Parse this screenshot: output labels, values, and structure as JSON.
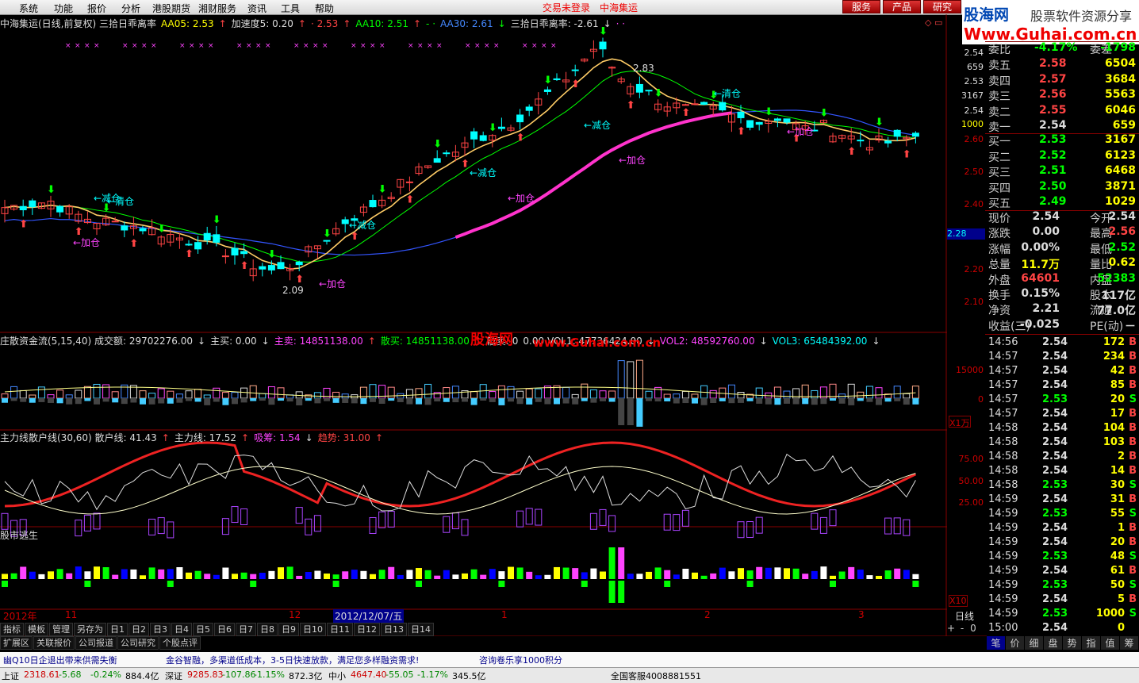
{
  "menu": [
    "系统",
    "功能",
    "报价",
    "分析",
    "港股期货",
    "湘财服务",
    "资讯",
    "工具",
    "帮助"
  ],
  "top_links": [
    "交易未登录",
    "中海集运"
  ],
  "top_buttons": [
    "服务",
    "产品",
    "研究"
  ],
  "logo": {
    "l1": "股海网",
    "l1b": "股票软件资源分享",
    "l2": "Www.Guhai.com.cn"
  },
  "main_header": [
    {
      "t": "中海集运(日线,前复权) 三拾日乖离率",
      "c": "w"
    },
    {
      "t": "AA05: 2.53",
      "c": "y"
    },
    {
      "t": "↑",
      "c": "r"
    },
    {
      "t": "加速度5: 0.20",
      "c": "w"
    },
    {
      "t": "↑",
      "c": "r"
    },
    {
      "t": "· 2.53",
      "c": "r"
    },
    {
      "t": "↑",
      "c": "r"
    },
    {
      "t": "AA10: 2.51",
      "c": "g"
    },
    {
      "t": "↑",
      "c": "r"
    },
    {
      "t": "- ·",
      "c": "g"
    },
    {
      "t": "AA30: 2.61",
      "c": "b"
    },
    {
      "t": "↓",
      "c": "g"
    },
    {
      "t": "三拾日乖离率: -2.61",
      "c": "w"
    },
    {
      "t": "↓",
      "c": "w"
    },
    {
      "t": "· ·",
      "c": "m"
    }
  ],
  "main_axis": [
    "2.60",
    "2.50",
    "2.40",
    "2.30",
    "2.20",
    "2.10"
  ],
  "cursor_price": "2.28",
  "annotations": [
    {
      "t": "←减仓",
      "c": "c"
    },
    {
      "t": "←清仓",
      "c": "c"
    },
    {
      "t": "←加仓",
      "c": "m"
    },
    {
      "t": "←减仓",
      "c": "c"
    },
    {
      "t": "←加仓",
      "c": "m"
    },
    {
      "t": "←减仓",
      "c": "c"
    },
    {
      "t": "←加仓",
      "c": "m"
    },
    {
      "t": "←减仓",
      "c": "c"
    },
    {
      "t": "←加仓",
      "c": "m"
    },
    {
      "t": "←清仓",
      "c": "c"
    },
    {
      "t": "←加仓",
      "c": "m"
    },
    {
      "t": "2.83",
      "c": "w"
    },
    {
      "t": "2.09",
      "c": "w"
    }
  ],
  "panel2_header": [
    {
      "t": "庄散资金流(5,15,40) 成交额: 29702276.00",
      "c": "w"
    },
    {
      "t": "↓",
      "c": "w"
    },
    {
      "t": "主买: 0.00",
      "c": "w"
    },
    {
      "t": "↓",
      "c": "w"
    },
    {
      "t": "主卖: 14851138.00",
      "c": "m"
    },
    {
      "t": "↑",
      "c": "r"
    },
    {
      "t": "散买: 14851138.00",
      "c": "g"
    },
    {
      "t": "↑",
      "c": "r"
    },
    {
      "t": "散卖: 0",
      "c": "w"
    },
    {
      "t": "0.00 VOL1: 47736424.00",
      "c": "w"
    },
    {
      "t": "↓",
      "c": "w"
    },
    {
      "t": "VOL2: 48592760.00",
      "c": "m"
    },
    {
      "t": "↓",
      "c": "w"
    },
    {
      "t": "VOL3: 65484392.00",
      "c": "c"
    },
    {
      "t": "↓",
      "c": "w"
    }
  ],
  "watermark2": {
    "a": "股海网",
    "b": "www.Guhai.com.cn"
  },
  "panel2_axis": [
    "15000",
    "0"
  ],
  "panel2_unit": "X1万",
  "panel3_header": [
    {
      "t": "主力线散户线(30,60) 散户线: 41.43",
      "c": "w"
    },
    {
      "t": "↑",
      "c": "r"
    },
    {
      "t": "主力线: 17.52",
      "c": "w"
    },
    {
      "t": "↑",
      "c": "r"
    },
    {
      "t": "吸筹: 1.54",
      "c": "m"
    },
    {
      "t": "↓",
      "c": "w"
    },
    {
      "t": "趋势: 31.00",
      "c": "r"
    },
    {
      "t": "↑",
      "c": "r"
    }
  ],
  "panel3_axis": [
    "75.00",
    "50.00",
    "25.00"
  ],
  "panel4_header": "股市逃生",
  "panel4_unit": "X10",
  "time_axis": [
    "2012年",
    "11",
    "12",
    "2012/12/07/五",
    "1",
    "2",
    "3"
  ],
  "period_label": "日线",
  "tabs1": [
    "指标",
    "模板",
    "管理",
    "另存为",
    "日1",
    "日2",
    "日3",
    "日4",
    "日5",
    "日6",
    "日7",
    "日8",
    "日9",
    "日10",
    "日11",
    "日12",
    "日13",
    "日14"
  ],
  "tabs2": [
    "扩展区",
    "关联报价",
    "公司报道",
    "公司研究",
    "个股点评"
  ],
  "zoom_buttons": [
    "+",
    "-",
    "0"
  ],
  "quote": {
    "wb": {
      "label": "委比",
      "val": "-4.17%",
      "label2": "委差",
      "val2": "-1798"
    },
    "asks": [
      {
        "l": "卖五",
        "p": "2.58",
        "v": "6504"
      },
      {
        "l": "卖四",
        "p": "2.57",
        "v": "3684"
      },
      {
        "l": "卖三",
        "p": "2.56",
        "v": "5563"
      },
      {
        "l": "卖二",
        "p": "2.55",
        "v": "6046"
      },
      {
        "l": "卖一",
        "p": "2.54",
        "v": "659"
      }
    ],
    "bids": [
      {
        "l": "买一",
        "p": "2.53",
        "v": "3167"
      },
      {
        "l": "买二",
        "p": "2.52",
        "v": "6123"
      },
      {
        "l": "买三",
        "p": "2.51",
        "v": "6468"
      },
      {
        "l": "买四",
        "p": "2.50",
        "v": "3871"
      },
      {
        "l": "买五",
        "p": "2.49",
        "v": "1029"
      }
    ],
    "left_axis": [
      "2.54",
      "659",
      "2.53",
      "3167",
      "2.54",
      "1000"
    ],
    "stats": [
      {
        "a": "现价",
        "b": "2.54",
        "c": "今开",
        "d": "2.54"
      },
      {
        "a": "涨跌",
        "b": "0.00",
        "c": "最高",
        "d": "2.56"
      },
      {
        "a": "涨幅",
        "b": "0.00%",
        "c": "最低",
        "d": "2.52"
      },
      {
        "a": "总量",
        "b": "11.7万",
        "c": "量比",
        "d": "0.62"
      },
      {
        "a": "外盘",
        "b": "64601",
        "c": "内盘",
        "d": "52383"
      },
      {
        "a": "换手",
        "b": "0.15%",
        "c": "股本",
        "d": "117亿"
      },
      {
        "a": "净资",
        "b": "2.21",
        "c": "流通",
        "d": "77.0亿"
      },
      {
        "a": "收益(三)",
        "b": "-0.025",
        "c": "PE(动)",
        "d": "－"
      }
    ]
  },
  "ticks": [
    [
      "14:56",
      "2.54",
      "172",
      "B"
    ],
    [
      "14:57",
      "2.54",
      "234",
      "B"
    ],
    [
      "14:57",
      "2.54",
      "42",
      "B"
    ],
    [
      "14:57",
      "2.54",
      "85",
      "B"
    ],
    [
      "14:57",
      "2.53",
      "20",
      "S"
    ],
    [
      "14:57",
      "2.54",
      "17",
      "B"
    ],
    [
      "14:58",
      "2.54",
      "104",
      "B"
    ],
    [
      "14:58",
      "2.54",
      "103",
      "B"
    ],
    [
      "14:58",
      "2.54",
      "2",
      "B"
    ],
    [
      "14:58",
      "2.54",
      "14",
      "B"
    ],
    [
      "14:58",
      "2.53",
      "30",
      "S"
    ],
    [
      "14:59",
      "2.54",
      "31",
      "B"
    ],
    [
      "14:59",
      "2.53",
      "55",
      "S"
    ],
    [
      "14:59",
      "2.54",
      "1",
      "B"
    ],
    [
      "14:59",
      "2.54",
      "20",
      "B"
    ],
    [
      "14:59",
      "2.53",
      "48",
      "S"
    ],
    [
      "14:59",
      "2.54",
      "61",
      "B"
    ],
    [
      "14:59",
      "2.53",
      "50",
      "S"
    ],
    [
      "14:59",
      "2.54",
      "5",
      "B"
    ],
    [
      "14:59",
      "2.53",
      "1000",
      "S"
    ],
    [
      "15:00",
      "2.54",
      "0",
      ""
    ]
  ],
  "right_tabs": [
    "笔",
    "价",
    "细",
    "盘",
    "势",
    "指",
    "值",
    "筹"
  ],
  "news": [
    "幽Q10日企退出带来供需失衡",
    "金谷智融，多渠道低成本，3-5日快速放款，满足您多样融资需求!",
    "咨询卷乐享1000积分"
  ],
  "indices": [
    {
      "name": "上证",
      "val": "2318.61",
      "chg": "-5.68",
      "pct": "-0.24%",
      "amt": "884.4亿"
    },
    {
      "name": "深证",
      "val": "9285.83",
      "chg": "-107.86",
      "pct": "-1.15%",
      "amt": "872.3亿"
    },
    {
      "name": "中小",
      "val": "4647.40",
      "chg": "-55.05",
      "pct": "-1.17%",
      "amt": "345.5亿"
    }
  ],
  "service": "全国客服4008881551",
  "colors": {
    "up": "#ff4444",
    "down": "#00ffff",
    "ma5": "#ffffff",
    "ma10": "#00ff00",
    "ma30": "#3355ff",
    "pink": "#ff33cc",
    "grid": "#880000"
  }
}
